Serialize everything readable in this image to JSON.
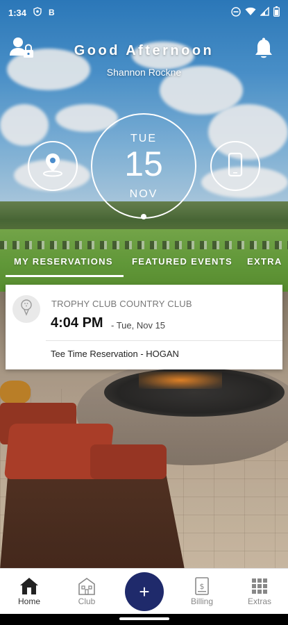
{
  "status_bar": {
    "time": "1:34",
    "left_icons": [
      "shield-icon",
      "b-icon"
    ],
    "right_icons": [
      "do-not-disturb-icon",
      "wifi-icon",
      "signal-icon",
      "battery-icon"
    ]
  },
  "header": {
    "greeting": "Good Afternoon",
    "user_name": "Shannon Rockne",
    "account_icon": "account-lock-icon",
    "notification_icon": "bell-icon"
  },
  "date_widget": {
    "day_of_week": "TUE",
    "day": "15",
    "month": "NOV"
  },
  "quick_buttons": {
    "left_icon": "location-pin-icon",
    "right_icon": "phone-icon"
  },
  "tabs": [
    {
      "label": "MY RESERVATIONS",
      "active": true
    },
    {
      "label": "FEATURED EVENTS",
      "active": false
    },
    {
      "label": "EXTRA",
      "active": false
    }
  ],
  "reservation": {
    "club_name": "TROPHY CLUB COUNTRY CLUB",
    "time": "4:04 PM",
    "date": "- Tue, Nov 15",
    "description": "Tee Time Reservation - HOGAN",
    "logo_icon": "golf-ball-icon"
  },
  "bottom_nav": [
    {
      "label": "Home",
      "icon": "home-icon"
    },
    {
      "label": "Club",
      "icon": "club-icon"
    },
    {
      "label": "Billing",
      "icon": "billing-icon"
    },
    {
      "label": "Extras",
      "icon": "grid-icon"
    }
  ],
  "fab": {
    "label": "+"
  },
  "colors": {
    "accent": "#1f2a6b",
    "card_bg": "#ffffff",
    "text_primary": "#111111",
    "text_muted": "#777777"
  }
}
